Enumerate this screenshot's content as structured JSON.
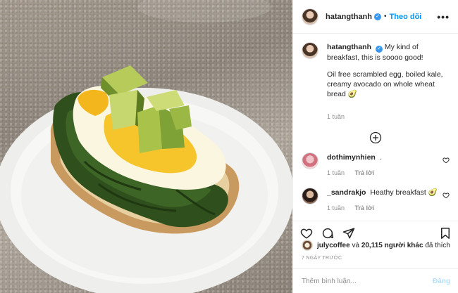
{
  "post": {
    "author": "hatangthanh",
    "follow_label": "Theo dõi",
    "separator": "•",
    "more_label": "•••",
    "caption_line1": "My kind of breakfast, this is soooo good!",
    "caption_line2": "Oil free scrambled egg, boiled kale, creamy avocado on whole wheat bread 🥑",
    "caption_time": "1 tuần"
  },
  "comments": [
    {
      "user": "dothimynhien",
      "text": ".",
      "time": "1 tuần",
      "reply": "Trả lời"
    },
    {
      "user": "_sandrakjo",
      "text": "Heathy breakfast 🥑",
      "time": "1 tuần",
      "reply": "Trả lời"
    }
  ],
  "likes": {
    "first_user": "julycoffee",
    "connector": "và",
    "count": "20,115 người khác",
    "suffix": "đã thích"
  },
  "date_label": "7 NGÀY TRƯỚC",
  "add_comment": {
    "placeholder": "Thêm bình luận...",
    "post_label": "Đăng"
  },
  "icons": {
    "verified": "verified-badge-icon",
    "heart": "heart-icon",
    "comment": "comment-icon",
    "share": "share-icon",
    "bookmark": "bookmark-icon",
    "load_more": "plus-circle-icon"
  },
  "colors": {
    "link_blue": "#0095f6",
    "post_disabled": "#b2dffc",
    "muted": "#8e8e8e"
  }
}
